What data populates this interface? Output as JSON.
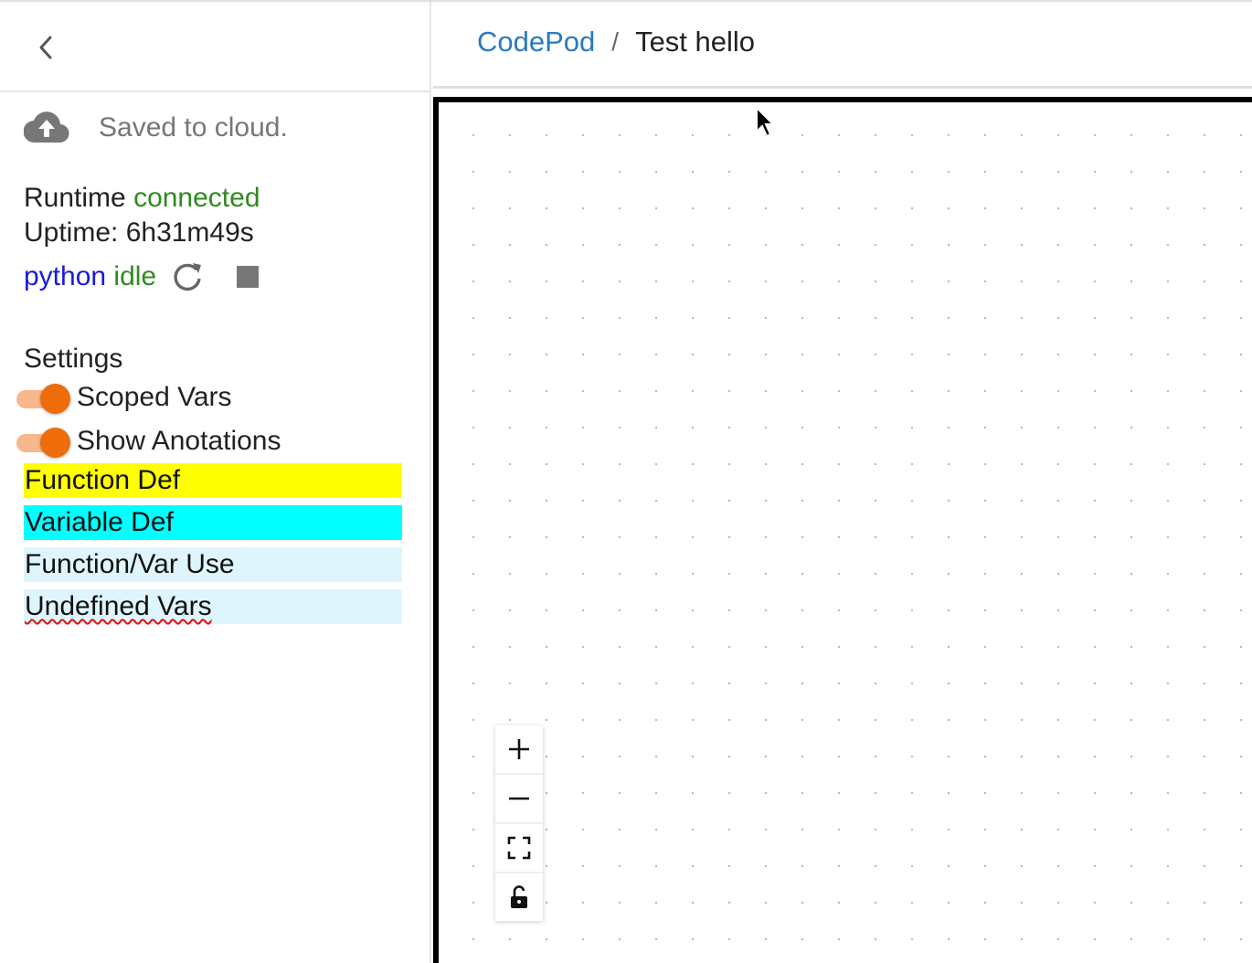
{
  "sidebar": {
    "status": {
      "text": "Saved to cloud.",
      "icon": "cloud-upload-icon"
    },
    "runtime": {
      "label": "Runtime",
      "status": "connected",
      "uptime": "Uptime: 6h31m49s"
    },
    "kernel": {
      "language": "python",
      "state": "idle",
      "restart_icon": "refresh-icon",
      "stop_icon": "stop-icon"
    },
    "settings": {
      "title": "Settings",
      "toggles": [
        {
          "label": "Scoped Vars",
          "on": true
        },
        {
          "label": "Show Anotations",
          "on": true
        }
      ],
      "legend": [
        {
          "label": "Function Def",
          "color": "#ffff00"
        },
        {
          "label": "Variable Def",
          "color": "#00ffff"
        },
        {
          "label": "Function/Var Use",
          "color": "#dff5fd"
        },
        {
          "label": "Undefined Vars",
          "color": "#dff5fd"
        }
      ]
    }
  },
  "header": {
    "breadcrumb": {
      "root": "CodePod",
      "separator": "/",
      "current": "Test hello"
    }
  },
  "canvas": {
    "controls": [
      "zoom-in-icon",
      "zoom-out-icon",
      "fit-view-icon",
      "unlock-icon"
    ]
  },
  "colors": {
    "accent_orange": "#ef6c0a",
    "link_blue": "#2a7ac0",
    "connected_green": "#2e8b1e",
    "python_blue": "#1a1adb"
  }
}
